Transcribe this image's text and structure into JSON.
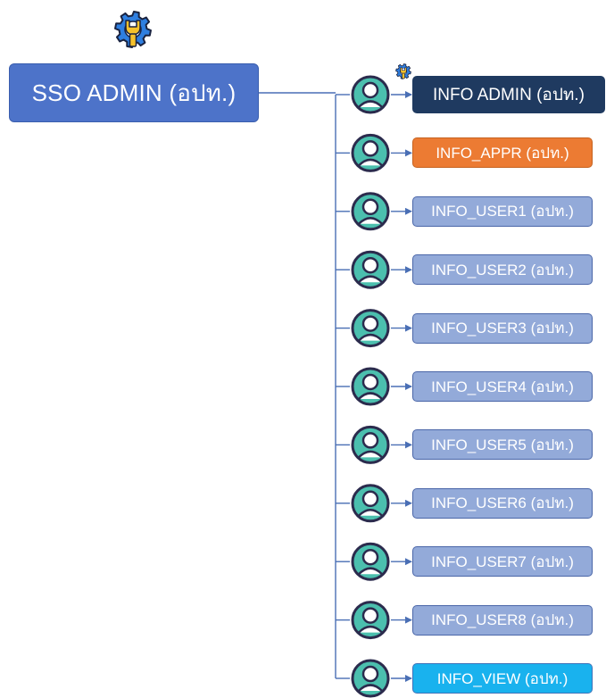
{
  "root": {
    "label": "SSO ADMIN (อปท.)",
    "icon": "gear-wrench-icon"
  },
  "roles": [
    {
      "label": "INFO ADMIN (อปท.)",
      "kind": "admin",
      "icon": "user-avatar-icon",
      "badge_icon": "gear-wrench-icon"
    },
    {
      "label": "INFO_APPR (อปท.)",
      "kind": "appr",
      "icon": "user-avatar-icon"
    },
    {
      "label": "INFO_USER1 (อปท.)",
      "kind": "user",
      "icon": "user-avatar-icon"
    },
    {
      "label": "INFO_USER2 (อปท.)",
      "kind": "user",
      "icon": "user-avatar-icon"
    },
    {
      "label": "INFO_USER3 (อปท.)",
      "kind": "user",
      "icon": "user-avatar-icon"
    },
    {
      "label": "INFO_USER4 (อปท.)",
      "kind": "user",
      "icon": "user-avatar-icon"
    },
    {
      "label": "INFO_USER5 (อปท.)",
      "kind": "user",
      "icon": "user-avatar-icon"
    },
    {
      "label": "INFO_USER6 (อปท.)",
      "kind": "user",
      "icon": "user-avatar-icon"
    },
    {
      "label": "INFO_USER7 (อปท.)",
      "kind": "user",
      "icon": "user-avatar-icon"
    },
    {
      "label": "INFO_USER8 (อปท.)",
      "kind": "user",
      "icon": "user-avatar-icon"
    },
    {
      "label": "INFO_VIEW (อปท.)",
      "kind": "view",
      "icon": "user-avatar-icon"
    }
  ],
  "colors": {
    "root": "#4d73c9",
    "admin": "#1f3a60",
    "appr": "#ec7b33",
    "user": "#93aad9",
    "view": "#19b2ee",
    "connector": "#4a6fb5",
    "avatar_fill": "#4bbfae",
    "avatar_outline": "#2b2b4d",
    "gear": "#2f7fe0",
    "wrench": "#f6c12b"
  }
}
